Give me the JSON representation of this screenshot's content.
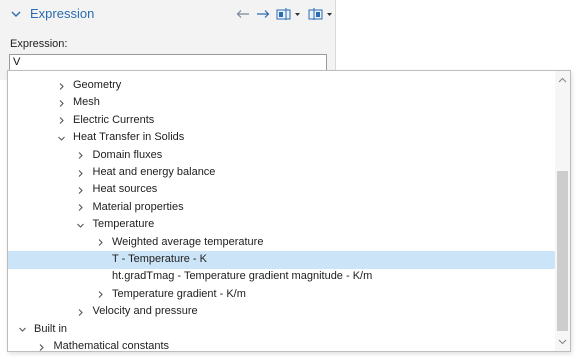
{
  "section": {
    "title": "Expression"
  },
  "expression": {
    "label": "Expression:",
    "value": "V"
  },
  "tree": {
    "items": [
      {
        "label": "Geometry",
        "level": 2,
        "state": "collapsed"
      },
      {
        "label": "Mesh",
        "level": 2,
        "state": "collapsed"
      },
      {
        "label": "Electric Currents",
        "level": 2,
        "state": "collapsed"
      },
      {
        "label": "Heat Transfer in Solids",
        "level": 2,
        "state": "expanded"
      },
      {
        "label": "Domain fluxes",
        "level": 3,
        "state": "collapsed"
      },
      {
        "label": "Heat and energy balance",
        "level": 3,
        "state": "collapsed"
      },
      {
        "label": "Heat sources",
        "level": 3,
        "state": "collapsed"
      },
      {
        "label": "Material properties",
        "level": 3,
        "state": "collapsed"
      },
      {
        "label": "Temperature",
        "level": 3,
        "state": "expanded"
      },
      {
        "label": "Weighted average temperature",
        "level": 4,
        "state": "collapsed"
      },
      {
        "label": "T - Temperature - K",
        "level": 4,
        "state": "leaf",
        "selected": true
      },
      {
        "label": "ht.gradTmag - Temperature gradient magnitude - K/m",
        "level": 4,
        "state": "leaf"
      },
      {
        "label": "Temperature gradient - K/m",
        "level": 4,
        "state": "collapsed"
      },
      {
        "label": "Velocity and pressure",
        "level": 3,
        "state": "collapsed"
      },
      {
        "label": "Built in",
        "level": 0,
        "state": "expanded"
      },
      {
        "label": "Mathematical constants",
        "level": 1,
        "state": "collapsed"
      }
    ]
  },
  "colors": {
    "accent": "#2b6cb0",
    "selection": "#cce4f7"
  }
}
